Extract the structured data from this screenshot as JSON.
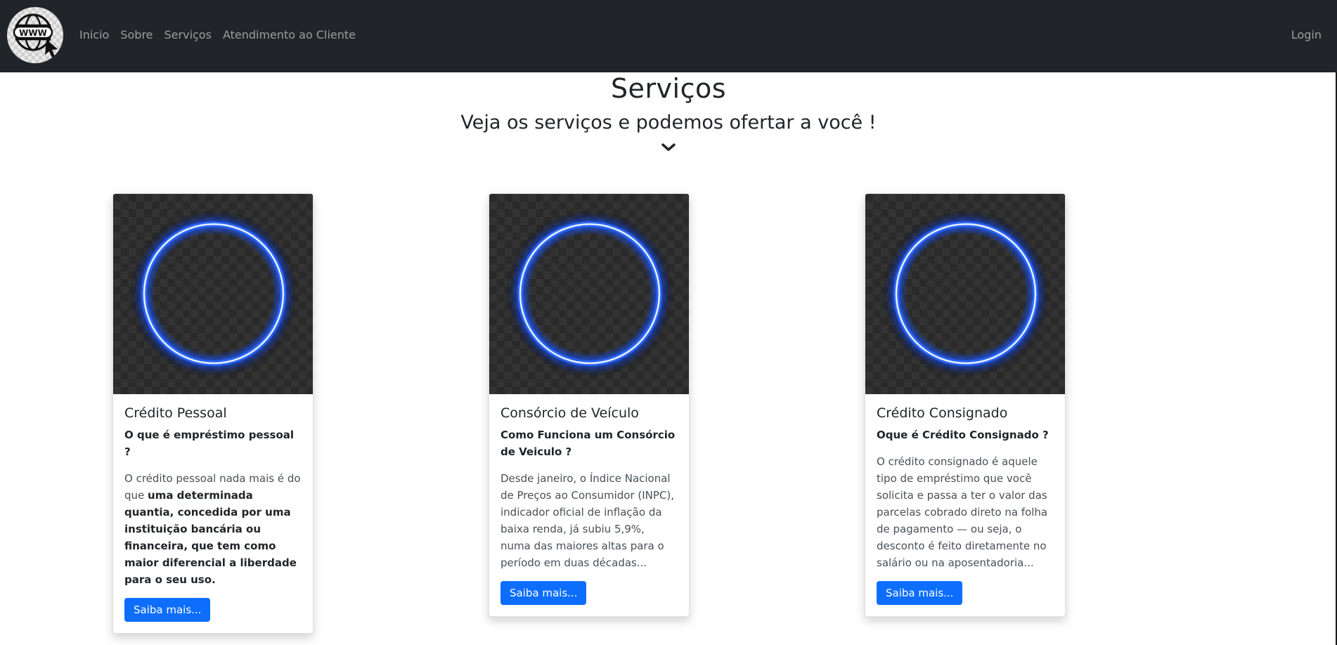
{
  "nav": {
    "logo_text": "WWW",
    "links": [
      "Inicio",
      "Sobre",
      "Serviços",
      "Atendimento ao Cliente"
    ],
    "login": "Login"
  },
  "hero": {
    "title": "Serviços",
    "subtitle": "Veja os serviços e podemos ofertar a você !",
    "chevron_icon": "chevron-down-icon"
  },
  "colors": {
    "navbar": "#212529",
    "button": "#0d6efd",
    "ring": "#3a7bff"
  },
  "cards": [
    {
      "title": "Crédito Pessoal",
      "subtitle": "O que é empréstimo pessoal ?",
      "text_plain": "O crédito pessoal nada mais é do que ",
      "text_bold": "uma determinada quantia, concedida por uma instituição bancária ou financeira, que tem como maior diferencial a liberdade para o seu uso.",
      "button": "Saiba mais..."
    },
    {
      "title": "Consórcio de Veículo",
      "subtitle": "Como Funciona um Consórcio de Veiculo ?",
      "text_plain": "Desde janeiro, o Índice Nacional de Preços ao Consumidor (INPC), indicador oficial de inflação da baixa renda, já subiu 5,9%, numa das maiores altas para o período em duas décadas...",
      "text_bold": "",
      "button": "Saiba mais..."
    },
    {
      "title": "Crédito Consignado",
      "subtitle": "Oque é Crédito Consignado ?",
      "text_plain": "O crédito consignado é aquele tipo de empréstimo que você solicita e passa a ter o valor das parcelas cobrado direto na folha de pagamento — ou seja, o desconto é feito diretamente no salário ou na aposentadoria...",
      "text_bold": "",
      "button": "Saiba mais..."
    }
  ]
}
